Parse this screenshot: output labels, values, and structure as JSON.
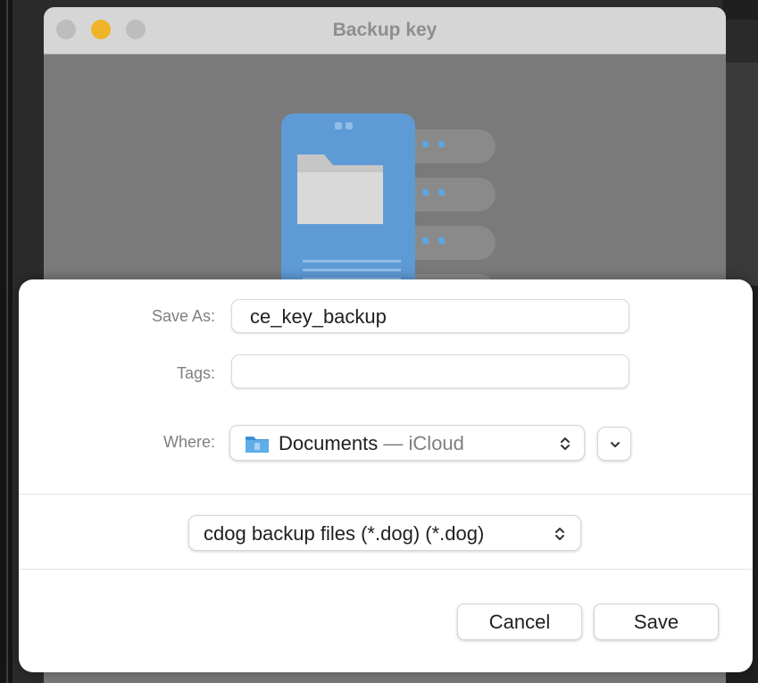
{
  "window": {
    "title": "Backup key"
  },
  "dialog": {
    "save_as_label": "Save As:",
    "save_as_value": "ce_key_backup",
    "tags_label": "Tags:",
    "tags_value": "",
    "where_label": "Where:",
    "where_folder": "Documents",
    "where_separator": "—",
    "where_location": "iCloud",
    "file_format": "cdog backup files (*.dog) (*.dog)",
    "cancel_label": "Cancel",
    "save_label": "Save"
  },
  "icons": {
    "folder": "folder-icon",
    "updown": "chevron-updown-icon",
    "expand": "chevron-down-icon"
  },
  "colors": {
    "minimize": "#f0b429",
    "folder_blue": "#4fa3e0"
  }
}
